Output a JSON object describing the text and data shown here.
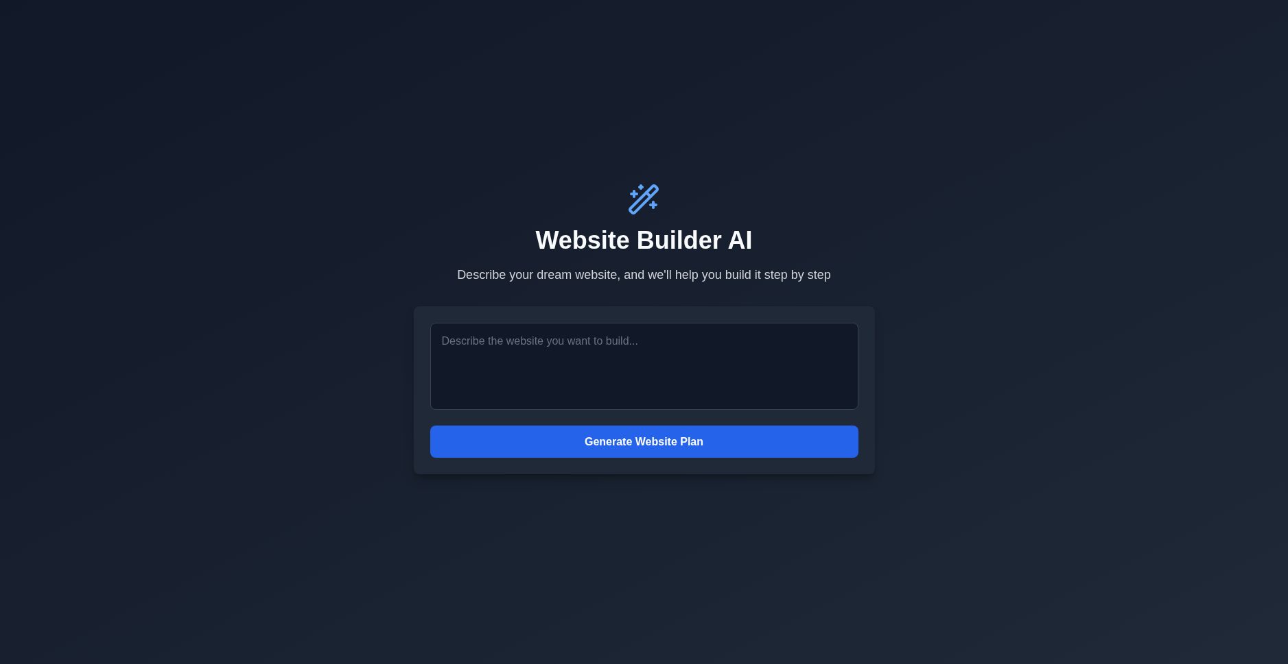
{
  "header": {
    "title": "Website Builder AI",
    "subtitle": "Describe your dream website, and we'll help you build it step by step"
  },
  "form": {
    "prompt": {
      "placeholder": "Describe the website you want to build..."
    },
    "submit_button": {
      "label": "Generate Website Plan"
    }
  }
}
